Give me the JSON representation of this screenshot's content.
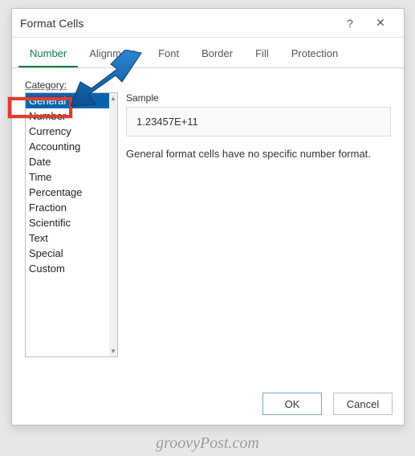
{
  "dialog": {
    "title": "Format Cells",
    "helpGlyph": "?",
    "closeGlyph": "✕"
  },
  "tabs": [
    {
      "label": "Number",
      "active": true
    },
    {
      "label": "Alignment",
      "active": false
    },
    {
      "label": "Font",
      "active": false
    },
    {
      "label": "Border",
      "active": false
    },
    {
      "label": "Fill",
      "active": false
    },
    {
      "label": "Protection",
      "active": false
    }
  ],
  "categoryLabel": "Category:",
  "categories": [
    "General",
    "Number",
    "Currency",
    "Accounting",
    "Date",
    "Time",
    "Percentage",
    "Fraction",
    "Scientific",
    "Text",
    "Special",
    "Custom"
  ],
  "selectedCategoryIndex": 0,
  "highlightedCategoryIndex": 1,
  "sample": {
    "label": "Sample",
    "value": "1.23457E+11"
  },
  "description": "General format cells have no specific number format.",
  "buttons": {
    "ok": "OK",
    "cancel": "Cancel"
  },
  "watermark": "groovyPost.com",
  "scroll": {
    "up": "▲",
    "down": "▼"
  }
}
